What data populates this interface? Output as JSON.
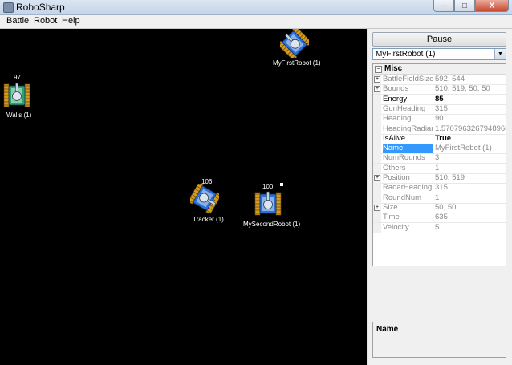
{
  "window": {
    "title": "RoboSharp",
    "min": "–",
    "max": "□",
    "close": "X"
  },
  "menu": [
    "Battle",
    "Robot",
    "Help"
  ],
  "battlefield": {
    "robots": [
      {
        "name": "MyFirstRobot (1)",
        "energy": "",
        "color": "#2a6fd6",
        "heading_deg": 315,
        "gun_deg": 315
      },
      {
        "name": "Walls (1)",
        "energy": "97",
        "color": "#2da36a",
        "heading_deg": 0,
        "gun_deg": 0
      },
      {
        "name": "Tracker (1)",
        "energy": "106",
        "color": "#2a6fd6",
        "heading_deg": 30,
        "gun_deg": 120
      },
      {
        "name": "MySecondRobot (1)",
        "energy": "100",
        "color": "#2a6fd6",
        "heading_deg": 0,
        "gun_deg": 0
      }
    ]
  },
  "panel": {
    "pause_label": "Pause",
    "selected_robot": "MyFirstRobot (1)",
    "category": "Misc",
    "properties": [
      {
        "name": "BattleFieldSize",
        "value": "592, 544",
        "expandable": true
      },
      {
        "name": "Bounds",
        "value": "510, 519, 50, 50",
        "expandable": true
      },
      {
        "name": "Energy",
        "value": "85",
        "editable": true
      },
      {
        "name": "GunHeading",
        "value": "315"
      },
      {
        "name": "Heading",
        "value": "90"
      },
      {
        "name": "HeadingRadians",
        "value": "1.5707963267948966"
      },
      {
        "name": "IsAlive",
        "value": "True",
        "editable": true
      },
      {
        "name": "Name",
        "value": "MyFirstRobot (1)",
        "selected": true
      },
      {
        "name": "NumRounds",
        "value": "3"
      },
      {
        "name": "Others",
        "value": "1"
      },
      {
        "name": "Position",
        "value": "510, 519",
        "expandable": true
      },
      {
        "name": "RadarHeading",
        "value": "315"
      },
      {
        "name": "RoundNum",
        "value": "1"
      },
      {
        "name": "Size",
        "value": "50, 50",
        "expandable": true
      },
      {
        "name": "Time",
        "value": "635"
      },
      {
        "name": "Velocity",
        "value": "5"
      }
    ],
    "description_title": "Name"
  }
}
